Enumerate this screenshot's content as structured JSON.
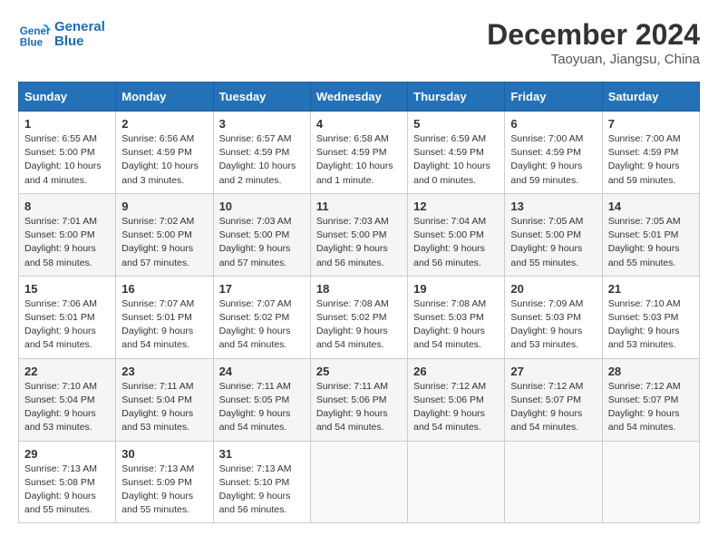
{
  "header": {
    "logo_line1": "General",
    "logo_line2": "Blue",
    "month": "December 2024",
    "location": "Taoyuan, Jiangsu, China"
  },
  "weekdays": [
    "Sunday",
    "Monday",
    "Tuesday",
    "Wednesday",
    "Thursday",
    "Friday",
    "Saturday"
  ],
  "weeks": [
    [
      {
        "day": "1",
        "sunrise": "6:55 AM",
        "sunset": "5:00 PM",
        "daylight": "10 hours and 4 minutes."
      },
      {
        "day": "2",
        "sunrise": "6:56 AM",
        "sunset": "4:59 PM",
        "daylight": "10 hours and 3 minutes."
      },
      {
        "day": "3",
        "sunrise": "6:57 AM",
        "sunset": "4:59 PM",
        "daylight": "10 hours and 2 minutes."
      },
      {
        "day": "4",
        "sunrise": "6:58 AM",
        "sunset": "4:59 PM",
        "daylight": "10 hours and 1 minute."
      },
      {
        "day": "5",
        "sunrise": "6:59 AM",
        "sunset": "4:59 PM",
        "daylight": "10 hours and 0 minutes."
      },
      {
        "day": "6",
        "sunrise": "7:00 AM",
        "sunset": "4:59 PM",
        "daylight": "9 hours and 59 minutes."
      },
      {
        "day": "7",
        "sunrise": "7:00 AM",
        "sunset": "4:59 PM",
        "daylight": "9 hours and 59 minutes."
      }
    ],
    [
      {
        "day": "8",
        "sunrise": "7:01 AM",
        "sunset": "5:00 PM",
        "daylight": "9 hours and 58 minutes."
      },
      {
        "day": "9",
        "sunrise": "7:02 AM",
        "sunset": "5:00 PM",
        "daylight": "9 hours and 57 minutes."
      },
      {
        "day": "10",
        "sunrise": "7:03 AM",
        "sunset": "5:00 PM",
        "daylight": "9 hours and 57 minutes."
      },
      {
        "day": "11",
        "sunrise": "7:03 AM",
        "sunset": "5:00 PM",
        "daylight": "9 hours and 56 minutes."
      },
      {
        "day": "12",
        "sunrise": "7:04 AM",
        "sunset": "5:00 PM",
        "daylight": "9 hours and 56 minutes."
      },
      {
        "day": "13",
        "sunrise": "7:05 AM",
        "sunset": "5:00 PM",
        "daylight": "9 hours and 55 minutes."
      },
      {
        "day": "14",
        "sunrise": "7:05 AM",
        "sunset": "5:01 PM",
        "daylight": "9 hours and 55 minutes."
      }
    ],
    [
      {
        "day": "15",
        "sunrise": "7:06 AM",
        "sunset": "5:01 PM",
        "daylight": "9 hours and 54 minutes."
      },
      {
        "day": "16",
        "sunrise": "7:07 AM",
        "sunset": "5:01 PM",
        "daylight": "9 hours and 54 minutes."
      },
      {
        "day": "17",
        "sunrise": "7:07 AM",
        "sunset": "5:02 PM",
        "daylight": "9 hours and 54 minutes."
      },
      {
        "day": "18",
        "sunrise": "7:08 AM",
        "sunset": "5:02 PM",
        "daylight": "9 hours and 54 minutes."
      },
      {
        "day": "19",
        "sunrise": "7:08 AM",
        "sunset": "5:03 PM",
        "daylight": "9 hours and 54 minutes."
      },
      {
        "day": "20",
        "sunrise": "7:09 AM",
        "sunset": "5:03 PM",
        "daylight": "9 hours and 53 minutes."
      },
      {
        "day": "21",
        "sunrise": "7:10 AM",
        "sunset": "5:03 PM",
        "daylight": "9 hours and 53 minutes."
      }
    ],
    [
      {
        "day": "22",
        "sunrise": "7:10 AM",
        "sunset": "5:04 PM",
        "daylight": "9 hours and 53 minutes."
      },
      {
        "day": "23",
        "sunrise": "7:11 AM",
        "sunset": "5:04 PM",
        "daylight": "9 hours and 53 minutes."
      },
      {
        "day": "24",
        "sunrise": "7:11 AM",
        "sunset": "5:05 PM",
        "daylight": "9 hours and 54 minutes."
      },
      {
        "day": "25",
        "sunrise": "7:11 AM",
        "sunset": "5:06 PM",
        "daylight": "9 hours and 54 minutes."
      },
      {
        "day": "26",
        "sunrise": "7:12 AM",
        "sunset": "5:06 PM",
        "daylight": "9 hours and 54 minutes."
      },
      {
        "day": "27",
        "sunrise": "7:12 AM",
        "sunset": "5:07 PM",
        "daylight": "9 hours and 54 minutes."
      },
      {
        "day": "28",
        "sunrise": "7:12 AM",
        "sunset": "5:07 PM",
        "daylight": "9 hours and 54 minutes."
      }
    ],
    [
      {
        "day": "29",
        "sunrise": "7:13 AM",
        "sunset": "5:08 PM",
        "daylight": "9 hours and 55 minutes."
      },
      {
        "day": "30",
        "sunrise": "7:13 AM",
        "sunset": "5:09 PM",
        "daylight": "9 hours and 55 minutes."
      },
      {
        "day": "31",
        "sunrise": "7:13 AM",
        "sunset": "5:10 PM",
        "daylight": "9 hours and 56 minutes."
      },
      null,
      null,
      null,
      null
    ]
  ]
}
